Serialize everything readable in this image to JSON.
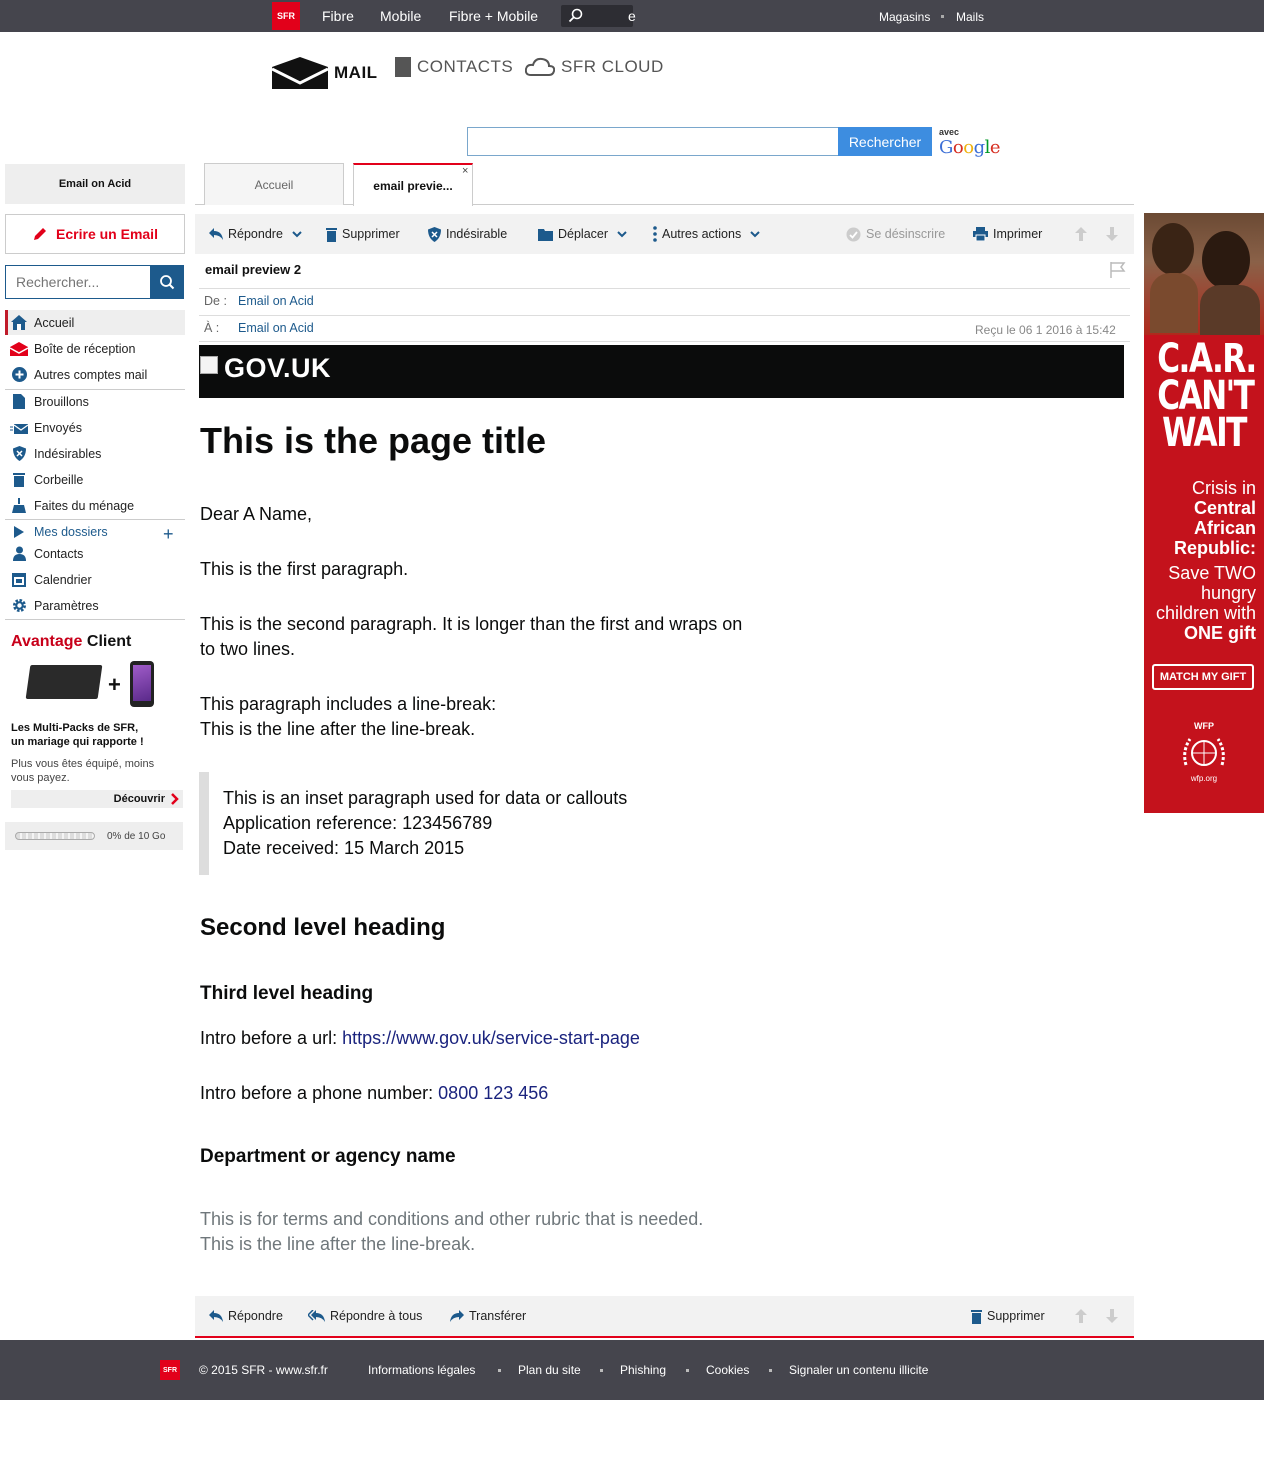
{
  "topbar": {
    "logo": "SFR",
    "nav": [
      "Fibre",
      "Mobile",
      "Fibre + Mobile"
    ],
    "search_tail": "e",
    "right": [
      "Magasins",
      "Mails"
    ]
  },
  "products": {
    "mail": "MAIL",
    "contacts": "CONTACTS",
    "cloud": "SFR CLOUD"
  },
  "websearch": {
    "value": "",
    "button": "Rechercher",
    "avec": "avec",
    "google": "Google"
  },
  "sidebar": {
    "account": "Email on Acid",
    "compose": "Ecrire un Email",
    "search_placeholder": "Rechercher...",
    "items": [
      {
        "label": "Accueil",
        "icon": "home-icon"
      },
      {
        "label": "Boîte de réception",
        "icon": "envelope-icon"
      },
      {
        "label": "Autres comptes mail",
        "icon": "plus-circle-icon"
      },
      {
        "label": "Brouillons",
        "icon": "draft-icon"
      },
      {
        "label": "Envoyés",
        "icon": "sent-icon"
      },
      {
        "label": "Indésirables",
        "icon": "shield-icon"
      },
      {
        "label": "Corbeille",
        "icon": "trash-icon"
      },
      {
        "label": "Faites du ménage",
        "icon": "broom-icon"
      },
      {
        "label": "Mes dossiers",
        "icon": "folder-arrow-icon"
      },
      {
        "label": "Contacts",
        "icon": "person-icon"
      },
      {
        "label": "Calendrier",
        "icon": "calendar-icon"
      },
      {
        "label": "Paramètres",
        "icon": "gear-icon"
      }
    ],
    "promo": {
      "title_red": "Avantage",
      "title_black": " Client",
      "plus": "+",
      "headline_1": "Les Multi-Packs de SFR,",
      "headline_2": "un mariage qui rapporte !",
      "text_1": "Plus vous êtes équipé, moins",
      "text_2": "vous payez.",
      "cta": "Découvrir"
    },
    "quota": {
      "text": "0% de 10 Go",
      "used_fraction": 0.0
    }
  },
  "tabs": [
    {
      "label": "Accueil"
    },
    {
      "label": "email previe..."
    }
  ],
  "tab_close": "×",
  "toolbar_top": {
    "reply": "Répondre",
    "delete": "Supprimer",
    "spam": "Indésirable",
    "move": "Déplacer",
    "more": "Autres actions",
    "unsubscribe": "Se désinscrire",
    "print": "Imprimer"
  },
  "message": {
    "subject": "email preview 2",
    "from_label": "De :",
    "from": "Email on Acid",
    "to_label": "À :",
    "to": "Email on Acid",
    "received": "Reçu le 06 1 2016 à 15:42"
  },
  "email": {
    "gov_logo": "GOV.UK",
    "title": "This is the page title",
    "greeting": "Dear A Name,",
    "p1": "This is the first paragraph.",
    "p2_line1": "This is the second paragraph. It is longer than the first and wraps on",
    "p2_line2": "to two lines.",
    "p3_line1": "This paragraph includes a line-break:",
    "p3_line2": "This is the line after the line-break.",
    "inset_1": "This is an inset paragraph used for data or callouts",
    "inset_2": "Application reference: 123456789",
    "inset_3": "Date received: 15 March 2015",
    "h2": "Second level heading",
    "h3": "Third level heading",
    "url_intro": "Intro before a url: ",
    "url": "https://www.gov.uk/service-start-page",
    "phone_intro": "Intro before a phone number: ",
    "phone": "0800 123 456",
    "dept": "Department or agency name",
    "terms_1": "This is for terms and conditions and other rubric that is needed.",
    "terms_2": "This is the line after the line-break."
  },
  "toolbar_bottom": {
    "reply": "Répondre",
    "reply_all": "Répondre à tous",
    "forward": "Transférer",
    "delete": "Supprimer"
  },
  "ad": {
    "headline_1": "C.A.R.",
    "headline_2": "CAN'T",
    "headline_3": "WAIT",
    "sub_1": "Crisis in",
    "sub_2": "Central",
    "sub_3": "African",
    "sub_4": "Republic:",
    "save_1": "Save TWO",
    "save_2": "hungry",
    "save_3": "children with",
    "save_4": "ONE gift",
    "button": "MATCH MY GIFT",
    "wfp": "WFP",
    "wfp_org": "wfp.org"
  },
  "footer": {
    "logo": "SFR",
    "copyright": "© 2015 SFR - www.sfr.fr",
    "links": [
      "Informations légales",
      "Plan du site",
      "Phishing",
      "Cookies",
      "Signaler un contenu illicite"
    ]
  },
  "colors": {
    "brand_red": "#e2001a",
    "topbar": "#45454d",
    "link_blue": "#1d5a8c",
    "gov_black": "#0b0c0c",
    "ad_red": "#c4121c"
  }
}
